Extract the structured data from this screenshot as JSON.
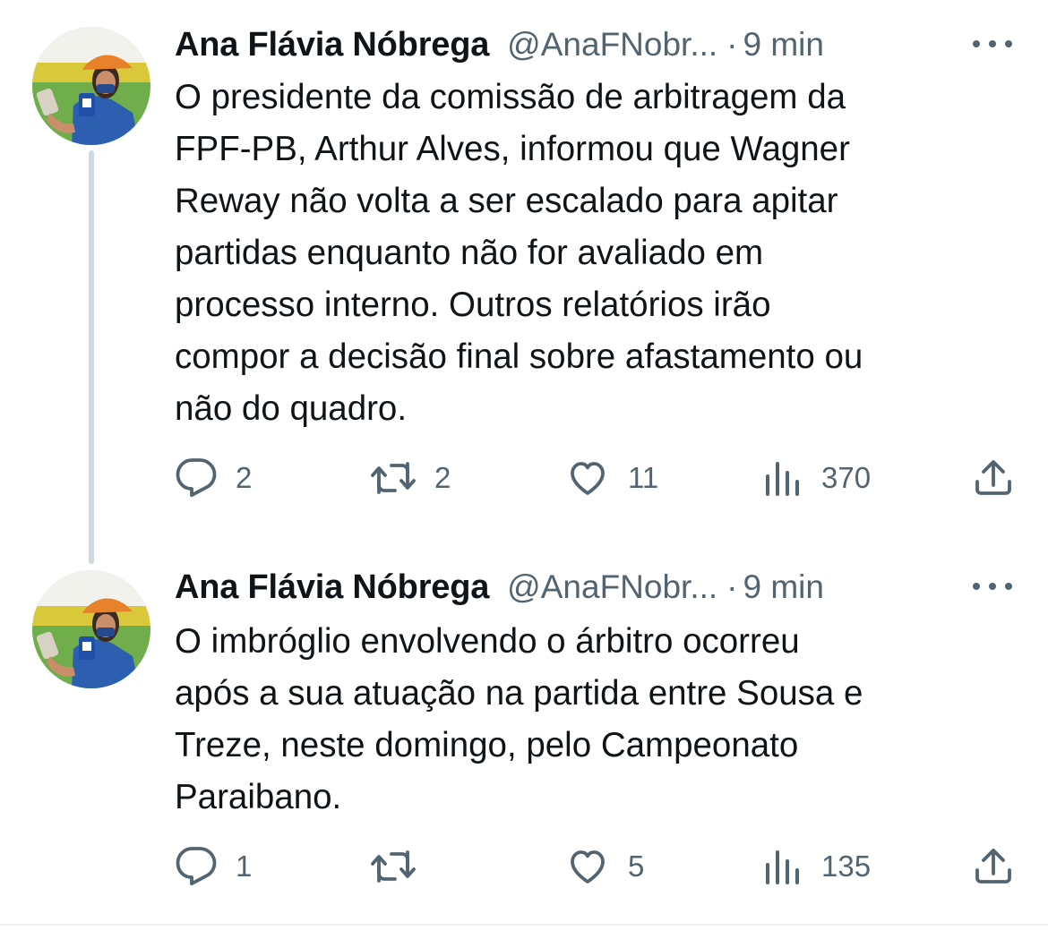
{
  "tweets": [
    {
      "author": {
        "display_name": "Ana Flávia Nóbrega",
        "handle": "@AnaFNobr...",
        "avatar": "profile-photo-woman-orange-cap"
      },
      "separator": "·",
      "time": "9 min",
      "text": "O presidente da comissão de arbitragem da\nFPF-PB, Arthur Alves, informou que Wagner\nReway não volta a ser escalado para apitar\npartidas enquanto não for avaliado em\nprocesso interno. Outros relatórios irão\ncompor a decisão final sobre afastamento ou\nnão do quadro.",
      "actions": {
        "replies": "2",
        "retweets": "2",
        "likes": "11",
        "views": "370"
      }
    },
    {
      "author": {
        "display_name": "Ana Flávia Nóbrega",
        "handle": "@AnaFNobr...",
        "avatar": "profile-photo-woman-orange-cap"
      },
      "separator": "·",
      "time": "9 min",
      "text": "O imbróglio envolvendo o árbitro ocorreu\napós a sua atuação na partida entre Sousa e\nTreze, neste domingo, pelo Campeonato\nParaibano.",
      "actions": {
        "replies": "1",
        "retweets": "",
        "likes": "5",
        "views": "135"
      }
    }
  ],
  "icons": {
    "more": "more-horizontal-icon",
    "reply": "reply-bubble-icon",
    "retweet": "retweet-icon",
    "like": "heart-icon",
    "views": "views-bar-chart-icon",
    "share": "share-upload-icon"
  },
  "colors": {
    "text_primary": "#0f1419",
    "text_secondary": "#536471",
    "thread_line": "#cfd9de",
    "background": "#ffffff",
    "avatar_cap": "#e8822a",
    "avatar_shirt": "#2d5fb0"
  }
}
